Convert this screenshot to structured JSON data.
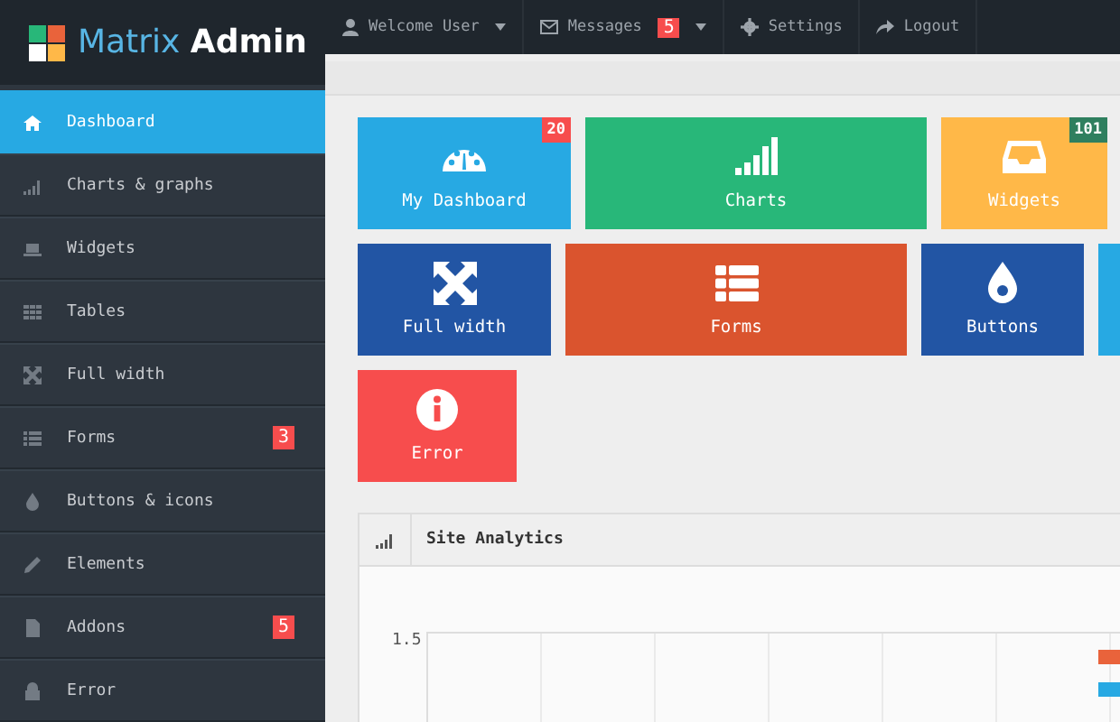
{
  "brand": {
    "name_light": "Matrix",
    "name_bold": "Admin"
  },
  "top_nav": [
    {
      "label": "Welcome User",
      "caret": true
    },
    {
      "label": "Messages",
      "badge": "5",
      "caret": true
    },
    {
      "label": "Settings",
      "caret": false
    },
    {
      "label": "Logout",
      "caret": false
    }
  ],
  "sidebar": {
    "items": [
      {
        "label": "Dashboard",
        "selected": true
      },
      {
        "label": "Charts & graphs",
        "selected": false
      },
      {
        "label": "Widgets",
        "selected": false
      },
      {
        "label": "Tables",
        "selected": false
      },
      {
        "label": "Full width",
        "selected": false
      },
      {
        "label": "Forms",
        "selected": false,
        "badge": "3"
      },
      {
        "label": "Buttons & icons",
        "selected": false
      },
      {
        "label": "Elements",
        "selected": false
      },
      {
        "label": "Addons",
        "selected": false,
        "badge": "5"
      },
      {
        "label": "Error",
        "selected": false
      }
    ]
  },
  "tiles": [
    [
      {
        "label": "My Dashboard",
        "color": "#27a9e3",
        "badge": {
          "text": "20",
          "color": "#f74d4d"
        }
      },
      {
        "label": "Charts",
        "color": "#28b779"
      },
      {
        "label": "Widgets",
        "color": "#ffb848",
        "badge": {
          "text": "101",
          "color": "#2f7f5f"
        }
      }
    ],
    [
      {
        "label": "Full width",
        "color": "#2255a4"
      },
      {
        "label": "Forms",
        "color": "#da542e"
      },
      {
        "label": "Buttons",
        "color": "#2255a4"
      },
      {
        "color": "#27a9e3"
      }
    ],
    [
      {
        "label": "Error",
        "color": "#f74d4d"
      }
    ]
  ],
  "panel": {
    "title": "Site Analytics",
    "y_label": "1.5",
    "legend": [
      {
        "color": "#e9633b"
      },
      {
        "color": "#27a9e3"
      }
    ]
  }
}
